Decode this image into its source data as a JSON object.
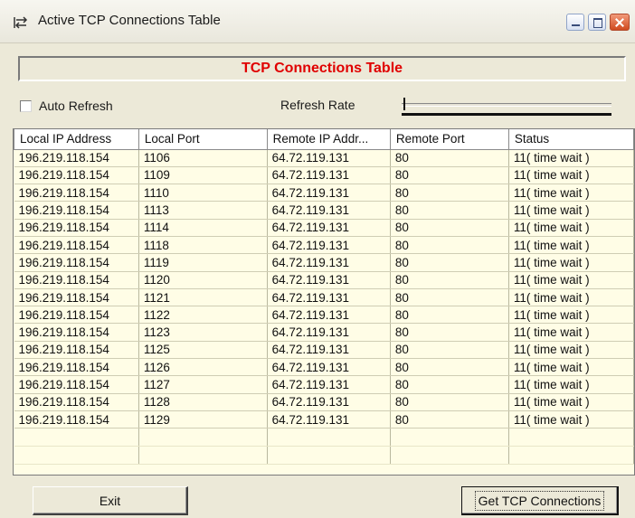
{
  "window": {
    "title": "Active TCP Connections Table"
  },
  "header": {
    "title": "TCP Connections Table"
  },
  "controls": {
    "auto_refresh_label": "Auto Refresh",
    "auto_refresh_checked": false,
    "refresh_rate_label": "Refresh Rate",
    "refresh_rate_level": 0
  },
  "table": {
    "columns": [
      "Local IP Address",
      "Local Port",
      "Remote IP Addr...",
      "Remote Port",
      "Status"
    ],
    "rows": [
      [
        "196.219.118.154",
        "1106",
        "64.72.119.131",
        "80",
        "11( time wait )"
      ],
      [
        "196.219.118.154",
        "1109",
        "64.72.119.131",
        "80",
        "11( time wait )"
      ],
      [
        "196.219.118.154",
        "1110",
        "64.72.119.131",
        "80",
        "11( time wait )"
      ],
      [
        "196.219.118.154",
        "1113",
        "64.72.119.131",
        "80",
        "11( time wait )"
      ],
      [
        "196.219.118.154",
        "1114",
        "64.72.119.131",
        "80",
        "11( time wait )"
      ],
      [
        "196.219.118.154",
        "1118",
        "64.72.119.131",
        "80",
        "11( time wait )"
      ],
      [
        "196.219.118.154",
        "1119",
        "64.72.119.131",
        "80",
        "11( time wait )"
      ],
      [
        "196.219.118.154",
        "1120",
        "64.72.119.131",
        "80",
        "11( time wait )"
      ],
      [
        "196.219.118.154",
        "1121",
        "64.72.119.131",
        "80",
        "11( time wait )"
      ],
      [
        "196.219.118.154",
        "1122",
        "64.72.119.131",
        "80",
        "11( time wait )"
      ],
      [
        "196.219.118.154",
        "1123",
        "64.72.119.131",
        "80",
        "11( time wait )"
      ],
      [
        "196.219.118.154",
        "1125",
        "64.72.119.131",
        "80",
        "11( time wait )"
      ],
      [
        "196.219.118.154",
        "1126",
        "64.72.119.131",
        "80",
        "11( time wait )"
      ],
      [
        "196.219.118.154",
        "1127",
        "64.72.119.131",
        "80",
        "11( time wait )"
      ],
      [
        "196.219.118.154",
        "1128",
        "64.72.119.131",
        "80",
        "11( time wait )"
      ],
      [
        "196.219.118.154",
        "1129",
        "64.72.119.131",
        "80",
        "11( time wait )"
      ]
    ]
  },
  "buttons": {
    "exit": "Exit",
    "get_connections": "Get TCP Connections"
  },
  "colors": {
    "header_title": "#e00000",
    "grid_background": "#fffde6",
    "window_background": "#ece9d8"
  }
}
